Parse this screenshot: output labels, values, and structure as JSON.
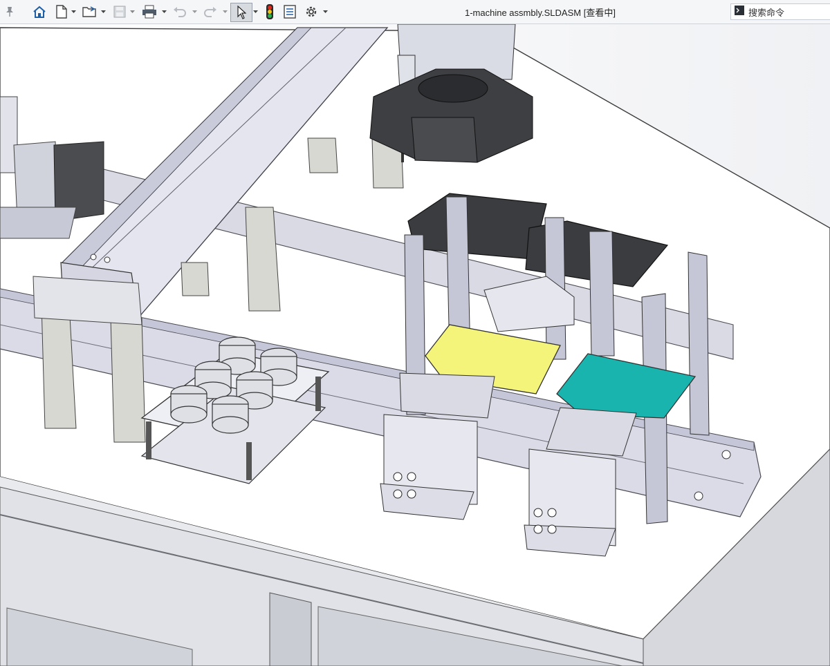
{
  "window": {
    "title": "1-machine assmbly.SLDASM [查看中]"
  },
  "toolbar": {
    "items": [
      {
        "name": "pin-icon"
      },
      {
        "name": "home-icon"
      },
      {
        "name": "new-document-icon"
      },
      {
        "name": "open-folder-icon"
      },
      {
        "name": "save-icon",
        "disabled": true
      },
      {
        "name": "print-icon"
      },
      {
        "name": "undo-icon",
        "disabled": true
      },
      {
        "name": "redo-icon",
        "disabled": true
      },
      {
        "name": "select-pointer-icon",
        "active": true
      },
      {
        "name": "traffic-light-icon"
      },
      {
        "name": "file-properties-icon"
      },
      {
        "name": "options-gear-icon"
      }
    ],
    "search": {
      "label": "搜索命令"
    }
  },
  "viewport": {
    "scene": "3d-assembly",
    "colors": {
      "background": "#ffffff",
      "frame": "#d9dde8",
      "dark_parts": "#3a3b3d",
      "yellow_plate": "#f4f37a",
      "teal_plate": "#19b4ae"
    }
  }
}
